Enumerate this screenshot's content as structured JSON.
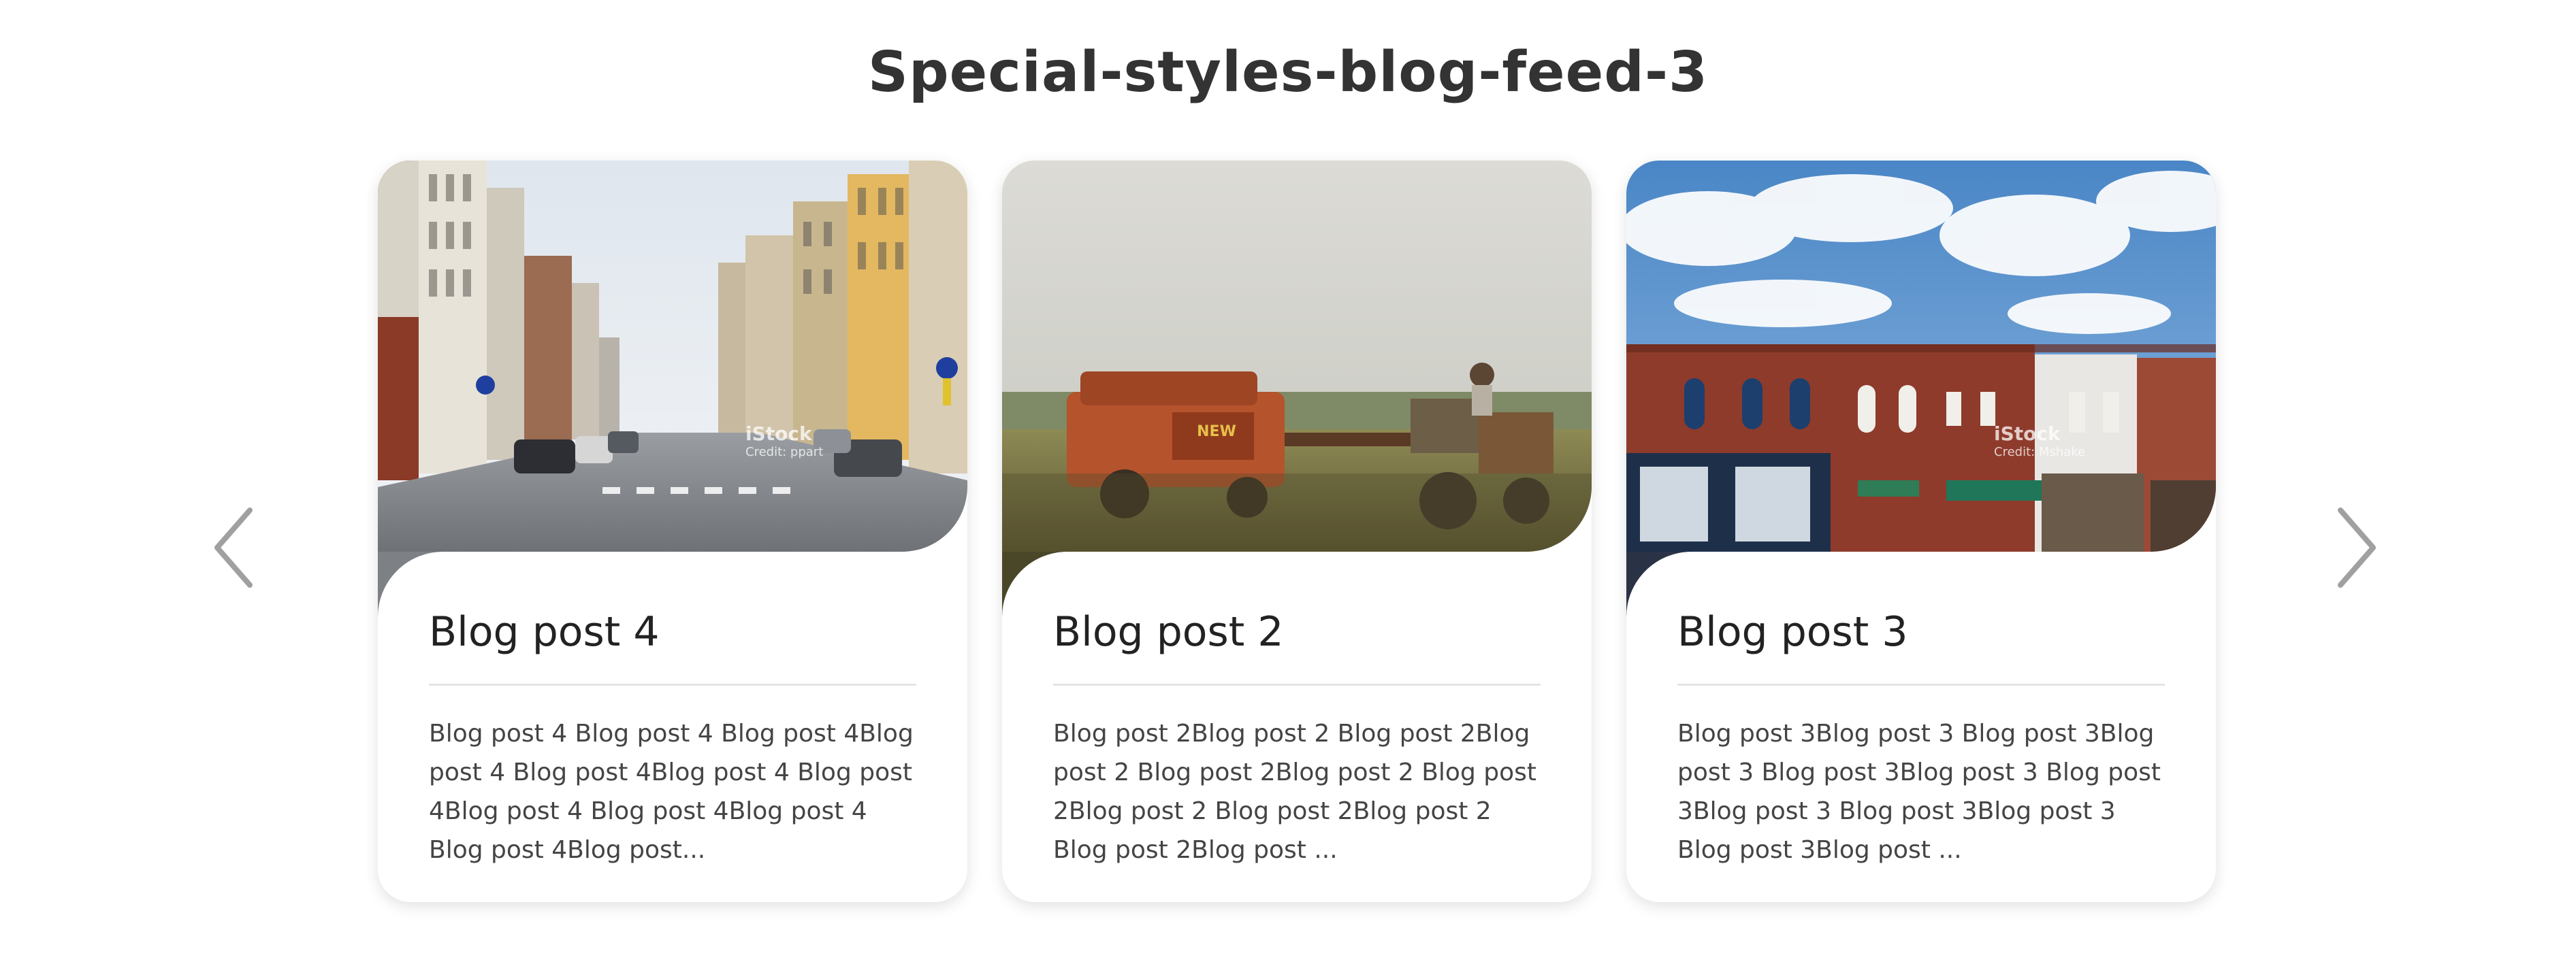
{
  "page": {
    "title": "Special-styles-blog-feed-3"
  },
  "carousel": {
    "prev_icon": "chevron-left-icon",
    "next_icon": "chevron-right-icon",
    "arrow_color": "#a0a0a0"
  },
  "posts": [
    {
      "title": "Blog post 4",
      "excerpt": "Blog post 4 Blog post 4 Blog post 4Blog post 4 Blog post 4Blog post 4 Blog post 4Blog post 4 Blog post 4Blog post 4 Blog post 4Blog post...",
      "image": "city-street-photo",
      "watermark_brand": "iStock",
      "watermark_credit": "Credit: ppart"
    },
    {
      "title": "Blog post 2",
      "excerpt": "Blog post 2Blog post 2 Blog post 2Blog post 2 Blog post 2Blog post 2 Blog post 2Blog post 2 Blog post 2Blog post 2 Blog post 2Blog post ...",
      "image": "farm-machinery-photo"
    },
    {
      "title": "Blog post 3",
      "excerpt": "Blog post 3Blog post 3 Blog post 3Blog post 3 Blog post 3Blog post 3 Blog post 3Blog post 3 Blog post 3Blog post 3 Blog post 3Blog post ...",
      "image": "main-street-storefronts-photo",
      "watermark_brand": "iStock",
      "watermark_credit": "Credit: Mshake"
    }
  ]
}
